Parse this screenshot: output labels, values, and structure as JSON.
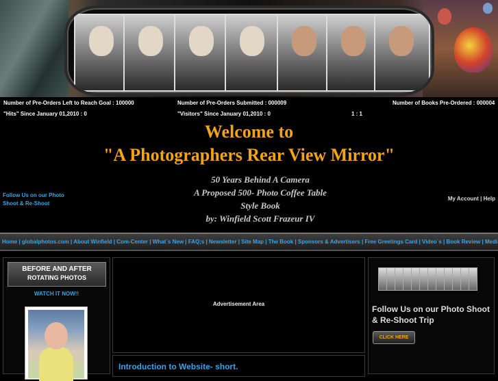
{
  "stats": {
    "row1": [
      {
        "label": "Number of Pre-Orders Left to Reach Goal : ",
        "value": "100000"
      },
      {
        "label": "Number of Pre-Orders Submitted : ",
        "value": "000009"
      },
      {
        "label": "Number of Books Pre-Ordered : ",
        "value": "000004"
      }
    ],
    "row2": [
      {
        "label": "\"Hits\" Since January 01,2010 : ",
        "value": "0"
      },
      {
        "label": "\"Visitors\" Since January 01,2010 : ",
        "value": "0"
      },
      {
        "label": "",
        "value": "1 : 1"
      }
    ]
  },
  "hero": {
    "welcome": "Welcome to",
    "title": "\"A Photographers Rear View Mirror\"",
    "subtitle_lines": [
      "50 Years Behind A Camera",
      "A Proposed 500- Photo Coffee Table",
      "Style Book",
      "by: Winfield Scott Frazeur IV"
    ]
  },
  "follow_left": "Follow Us on our Photo Shoot & Re-Shoot",
  "account": {
    "my_account": "My Account",
    "separator": "|",
    "help": "Help"
  },
  "nav": [
    "Home",
    "globalphotos.com",
    "About Winfield",
    "Com-Center",
    "What`s New",
    "FAQ;s",
    "Newsletter",
    "Site Map",
    "The Book",
    "Sponsors & Advertisers",
    "Free Greetings Card",
    "Video`s",
    "Book Review",
    "Media"
  ],
  "left_panel": {
    "heading1": "BEFORE AND AFTER",
    "heading2": "ROTATING PHOTOS",
    "watch": "WATCH IT NOW!!"
  },
  "ad_panel": {
    "text": "Advertisement Area"
  },
  "intro_panel": {
    "title": "Introduction to Website- short."
  },
  "right_panel": {
    "follow": "Follow Us on our Photo Shoot & Re-Shoot Trip",
    "button": "CLICK HERE"
  },
  "colors": {
    "accent_orange": "#f3a413",
    "link_blue": "#3ba3e6",
    "background": "#000000"
  }
}
